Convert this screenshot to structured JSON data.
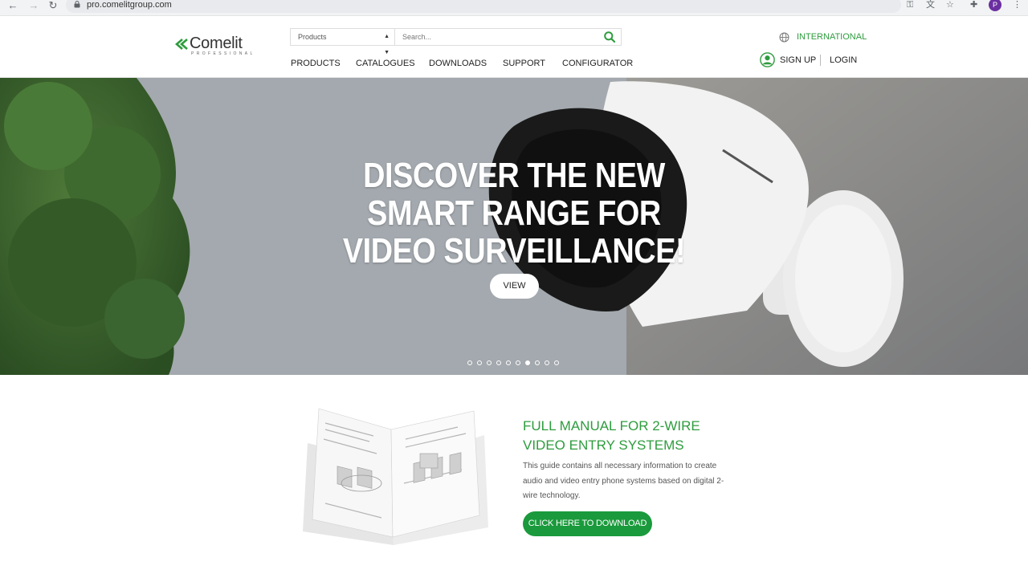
{
  "browser": {
    "url": "pro.comelitgroup.com",
    "profile_initial": "P"
  },
  "header": {
    "logo_text": "Comelit",
    "logo_sub": "PROFESSIONAL",
    "search": {
      "category": "Products",
      "placeholder": "Search..."
    },
    "nav": [
      "PRODUCTS",
      "CATALOGUES",
      "DOWNLOADS",
      "SUPPORT",
      "CONFIGURATOR"
    ],
    "region": "INTERNATIONAL",
    "signup": "SIGN UP",
    "login": "LOGIN"
  },
  "hero": {
    "title": "DISCOVER THE NEW SMART RANGE FOR VIDEO SURVEILLANCE!",
    "button": "VIEW",
    "slide_count": 10,
    "active_slide": 7
  },
  "promo": {
    "title": "FULL MANUAL FOR 2-WIRE VIDEO ENTRY SYSTEMS",
    "text": "This guide contains all necessary information to create audio and video entry phone systems based on digital 2-wire technology.",
    "button": "CLICK HERE TO DOWNLOAD"
  },
  "colors": {
    "brand_green": "#2e9c3e",
    "button_green": "#1a9a3c"
  }
}
